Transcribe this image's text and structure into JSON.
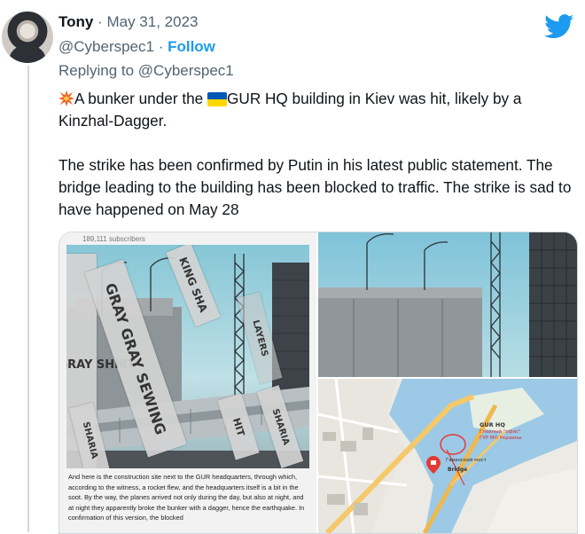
{
  "tweet": {
    "author_name": "Tony",
    "date": " · May 31, 2023",
    "handle": "@Cyberspec1",
    "separator": " · ",
    "follow_label": "Follow",
    "reply_prefix": "Replying to ",
    "reply_handle": "@Cyberspec1",
    "line1_a": "A bunker under the ",
    "line1_b": "GUR HQ building in Kiev was hit, likely by a Kinzhal-Dagger.",
    "paragraph2": "The strike has been confirmed by Putin in his latest public statement. The bridge leading to the building has been blocked to traffic. The strike is sad to have happened on May 28"
  },
  "media": {
    "left_image": {
      "subscribers": "189,111 subscribers",
      "labels": [
        "GIFT GRAY SHIRT",
        "GRAY GRAY SEWING",
        "KING SHA",
        "LAYERS",
        "SHARIA",
        "HIT",
        "SHARIA"
      ],
      "caption": "And here is the construction site next to the GUR headquarters, through which, according to the witness, a rocket flew, and the headquarters itself is a bit in the soot. By the way, the planes arrived not only during the day, but also at night, and at night they apparently broke the bunker with a dagger, hence the earthquake. In confirmation of this version, the blocked"
    },
    "map": {
      "hq_label": "GUR HQ",
      "hq_sublabel_1": "Главный \"офис\"",
      "hq_sublabel_2": "ГУР МО Украины",
      "bridge_label_ru": "Гаванский мост",
      "bridge_label": "Bridge"
    }
  },
  "colors": {
    "link": "#1d9bf0",
    "muted": "#536471",
    "text": "#0f1419"
  },
  "icons": [
    "twitter-bird-icon",
    "collision-emoji-icon",
    "ukraine-flag-emoji-icon",
    "map-pin-icon"
  ]
}
